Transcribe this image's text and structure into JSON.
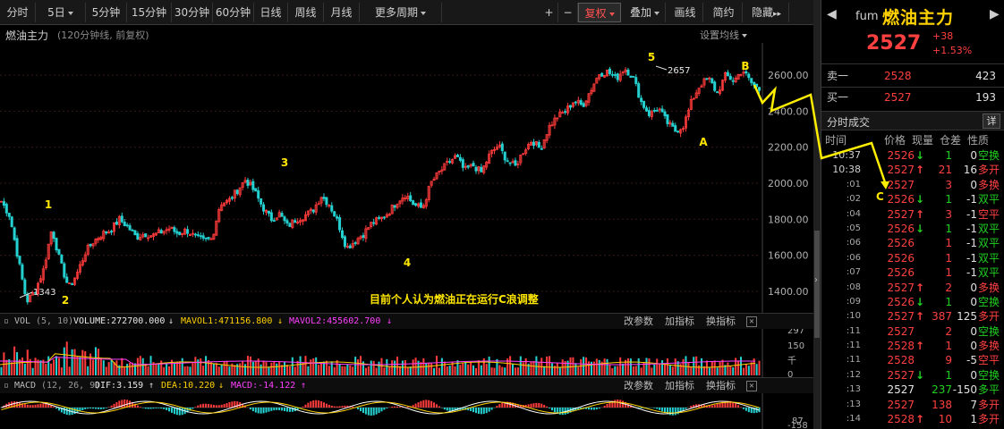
{
  "toolbar": {
    "items": [
      {
        "label": "分时",
        "caret": false
      },
      {
        "label": "5日",
        "caret": true
      },
      {
        "label": "5分钟",
        "caret": false
      },
      {
        "label": "15分钟",
        "caret": false
      },
      {
        "label": "30分钟",
        "caret": false
      },
      {
        "label": "60分钟",
        "caret": false
      },
      {
        "label": "日线",
        "caret": false
      },
      {
        "label": "周线",
        "caret": false
      },
      {
        "label": "月线",
        "caret": false
      },
      {
        "label": "更多周期",
        "caret": true
      }
    ],
    "right_items": [
      {
        "label": "+",
        "caret": false
      },
      {
        "label": "−",
        "caret": false
      },
      {
        "label": "复权",
        "caret": true,
        "active": true
      },
      {
        "label": "叠加",
        "caret": true
      },
      {
        "label": "画线",
        "caret": false
      },
      {
        "label": "简约",
        "caret": false
      },
      {
        "label": "隐藏",
        "caret": false,
        "suffix": "▸▸"
      }
    ]
  },
  "chart": {
    "title": "燃油主力",
    "subtitle": "(120分钟线, 前复权)",
    "settings_label": "设置均线",
    "annotation": "目前个人认为燃油正在运行C浪调整",
    "max_label": "2657",
    "min_label": "1343",
    "wave_labels": [
      "1",
      "2",
      "3",
      "4",
      "5",
      "A",
      "B",
      "C"
    ]
  },
  "chart_data": {
    "type": "candlestick",
    "y_axis_ticks": [
      2600,
      2400,
      2200,
      2000,
      1800,
      1600,
      1400
    ],
    "ylim": [
      1300,
      2700
    ],
    "grid": true,
    "waves": [
      {
        "label": "1",
        "price": 1750
      },
      {
        "label": "2",
        "price": 1343
      },
      {
        "label": "3",
        "price": 2020
      },
      {
        "label": "4",
        "price": 1640
      },
      {
        "label": "5",
        "price": 2657
      },
      {
        "label": "A",
        "price": 2290
      },
      {
        "label": "B",
        "price": 2630
      },
      {
        "label": "C",
        "price": 1980
      }
    ],
    "close_path": [
      1900,
      1820,
      1580,
      1343,
      1400,
      1520,
      1750,
      1560,
      1420,
      1500,
      1620,
      1680,
      1720,
      1740,
      1800,
      1760,
      1700,
      1720,
      1710,
      1730,
      1750,
      1720,
      1740,
      1700,
      1680,
      1690,
      1890,
      1900,
      1960,
      2020,
      1960,
      1870,
      1800,
      1830,
      1760,
      1800,
      1820,
      1850,
      1930,
      1880,
      1780,
      1640,
      1680,
      1720,
      1780,
      1800,
      1840,
      1900,
      1940,
      1880,
      1860,
      2000,
      2060,
      2110,
      2150,
      2070,
      2100,
      2060,
      2160,
      2210,
      2130,
      2090,
      2180,
      2240,
      2190,
      2310,
      2370,
      2400,
      2460,
      2430,
      2520,
      2610,
      2620,
      2580,
      2640,
      2590,
      2450,
      2380,
      2420,
      2340,
      2290,
      2320,
      2460,
      2550,
      2580,
      2500,
      2600,
      2570,
      2630,
      2560,
      2520
    ]
  },
  "vol_panel": {
    "label": "VOL",
    "params": "(5, 10)",
    "volume": "VOLUME:272700.000",
    "mavol1": "MAVOL1:471156.800",
    "mavol2": "MAVOL2:455602.700",
    "btn_params": "改参数",
    "btn_add": "加指标",
    "btn_switch": "换指标",
    "axis_top": "297",
    "axis_mid": "150",
    "axis_unit": "千",
    "axis_bottom": "0"
  },
  "macd_panel": {
    "label": "MACD",
    "params": "(12, 26, 9)",
    "dif": "DIF:3.159",
    "dea": "DEA:10.220",
    "macd": "MACD:-14.122",
    "btn_params": "改参数",
    "btn_add": "加指标",
    "btn_switch": "换指标",
    "axis_top": "87",
    "axis_bottom": "-158"
  },
  "quote": {
    "code": "fum",
    "name": "燃油主力",
    "price": "2527",
    "change": "+38",
    "change_pct": "+1.53%",
    "sell1_label": "卖一",
    "sell1_price": "2528",
    "sell1_vol": "423",
    "buy1_label": "买一",
    "buy1_price": "2527",
    "buy1_vol": "193"
  },
  "trades": {
    "title": "分时成交",
    "detail_btn": "详",
    "col_time": "时间",
    "col_price": "价格",
    "col_vol": "现量",
    "col_oi": "仓差",
    "col_type": "性质",
    "rows": [
      {
        "time": "10:37",
        "price": "2526",
        "dir": "↓",
        "vol": "1",
        "oi": "0",
        "type": "空换",
        "pc": "red",
        "tc": "green",
        "big": true
      },
      {
        "time": "10:38",
        "price": "2527",
        "dir": "↑",
        "vol": "21",
        "oi": "16",
        "type": "多开",
        "pc": "red",
        "tc": "red",
        "big": true
      },
      {
        "time": ":01",
        "price": "2527",
        "dir": "",
        "vol": "3",
        "oi": "0",
        "type": "多换",
        "pc": "red",
        "tc": "red",
        "big": false
      },
      {
        "time": ":02",
        "price": "2526",
        "dir": "↓",
        "vol": "1",
        "oi": "-1",
        "type": "双平",
        "pc": "red",
        "tc": "green",
        "big": false
      },
      {
        "time": ":04",
        "price": "2527",
        "dir": "↑",
        "vol": "3",
        "oi": "-1",
        "type": "空平",
        "pc": "red",
        "tc": "red",
        "big": false
      },
      {
        "time": ":05",
        "price": "2526",
        "dir": "↓",
        "vol": "1",
        "oi": "-1",
        "type": "双平",
        "pc": "red",
        "tc": "green",
        "big": false
      },
      {
        "time": ":06",
        "price": "2526",
        "dir": "",
        "vol": "1",
        "oi": "-1",
        "type": "双平",
        "pc": "red",
        "tc": "green",
        "big": false
      },
      {
        "time": ":06",
        "price": "2526",
        "dir": "",
        "vol": "1",
        "oi": "-1",
        "type": "双平",
        "pc": "red",
        "tc": "green",
        "big": false
      },
      {
        "time": ":07",
        "price": "2526",
        "dir": "",
        "vol": "1",
        "oi": "-1",
        "type": "双平",
        "pc": "red",
        "tc": "green",
        "big": false
      },
      {
        "time": ":08",
        "price": "2527",
        "dir": "↑",
        "vol": "2",
        "oi": "0",
        "type": "多换",
        "pc": "red",
        "tc": "red",
        "big": false
      },
      {
        "time": ":09",
        "price": "2526",
        "dir": "↓",
        "vol": "1",
        "oi": "0",
        "type": "空换",
        "pc": "red",
        "tc": "green",
        "big": false
      },
      {
        "time": ":10",
        "price": "2527",
        "dir": "↑",
        "vol": "387",
        "oi": "125",
        "type": "多开",
        "pc": "red",
        "tc": "red",
        "big": false
      },
      {
        "time": ":11",
        "price": "2527",
        "dir": "",
        "vol": "2",
        "oi": "0",
        "type": "空换",
        "pc": "red",
        "tc": "green",
        "big": false
      },
      {
        "time": ":11",
        "price": "2528",
        "dir": "↑",
        "vol": "1",
        "oi": "0",
        "type": "多换",
        "pc": "red",
        "tc": "red",
        "big": false
      },
      {
        "time": ":11",
        "price": "2528",
        "dir": "",
        "vol": "9",
        "oi": "-5",
        "type": "空平",
        "pc": "red",
        "tc": "red",
        "big": false
      },
      {
        "time": ":12",
        "price": "2527",
        "dir": "↓",
        "vol": "1",
        "oi": "0",
        "type": "空换",
        "pc": "red",
        "tc": "green",
        "big": false
      },
      {
        "time": ":13",
        "price": "2527",
        "dir": "",
        "vol": "237",
        "oi": "-150",
        "type": "多平",
        "pc": "white",
        "tc": "green",
        "big": false
      },
      {
        "time": ":13",
        "price": "2527",
        "dir": "",
        "vol": "138",
        "oi": "7",
        "type": "多开",
        "pc": "red",
        "tc": "red",
        "big": false
      },
      {
        "time": ":14",
        "price": "2528",
        "dir": "↑",
        "vol": "10",
        "oi": "1",
        "type": "多开",
        "pc": "red",
        "tc": "red",
        "big": false
      }
    ]
  },
  "colors": {
    "up": "#ff3b3b",
    "down": "#24d0d0",
    "wave_label": "#ffe600",
    "projection": "#ffee00",
    "ma1": "#ffffff",
    "ma2": "#ffd200",
    "mavol2": "#ff40ff"
  }
}
